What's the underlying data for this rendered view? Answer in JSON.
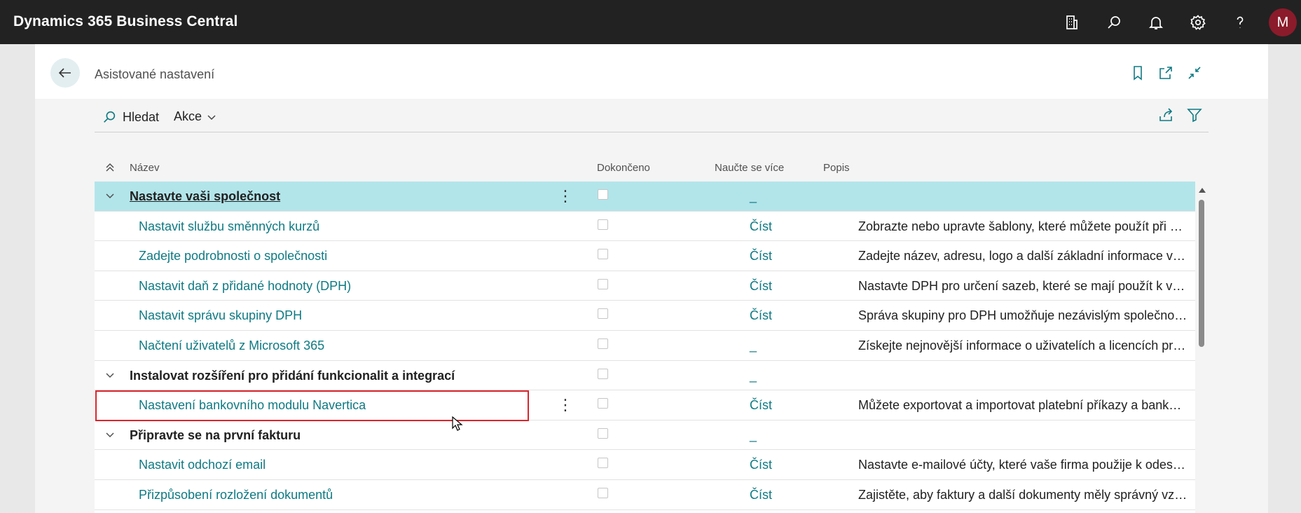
{
  "app": {
    "title": "Dynamics 365 Business Central",
    "avatar_initial": "M"
  },
  "page": {
    "title": "Asistované nastavení"
  },
  "toolbar": {
    "search_label": "Hledat",
    "actions_label": "Akce"
  },
  "columns": {
    "name": "Název",
    "completed": "Dokončeno",
    "learn_more": "Naučte se více",
    "description": "Popis"
  },
  "rows": [
    {
      "type": "group",
      "name": "Nastavte vaši společnost",
      "learn": "_",
      "desc": "",
      "selected": true
    },
    {
      "type": "item",
      "name": "Nastavit službu směnných kurzů",
      "learn": "Číst",
      "desc": "Zobrazte nebo upravte šablony, které můžete použít při vytváření i…"
    },
    {
      "type": "item",
      "name": "Zadejte podrobnosti o společnosti",
      "learn": "Číst",
      "desc": "Zadejte název, adresu, logo a další základní informace vaší společn…"
    },
    {
      "type": "item",
      "name": "Nastavit daň z přidané hodnoty (DPH)",
      "learn": "Číst",
      "desc": "Nastavte DPH pro určení sazeb, které se mají použít k výpočtu část…"
    },
    {
      "type": "item",
      "name": "Nastavit správu skupiny DPH",
      "learn": "Číst",
      "desc": "Správa skupiny pro DPH umožňuje nezávislým společnostem vstou…"
    },
    {
      "type": "item",
      "name": "Načtení uživatelů z Microsoft 365",
      "learn": "_",
      "desc": "Získejte nejnovější informace o uživatelích a licencích pro Business …"
    },
    {
      "type": "group",
      "name": "Instalovat rozšíření pro přidání funkcionalit a integrací",
      "learn": "_",
      "desc": ""
    },
    {
      "type": "item",
      "name": "Nastavení bankovního modulu Navertica",
      "learn": "Číst",
      "desc": "Můžete exportovat a importovat platební příkazy a bankovní výpisy.",
      "menu": true
    },
    {
      "type": "group",
      "name": "Připravte se na první fakturu",
      "learn": "_",
      "desc": ""
    },
    {
      "type": "item",
      "name": "Nastavit odchozí email",
      "learn": "Číst",
      "desc": "Nastavte e-mailové účty, které vaše firma použije k odesílání faktur…"
    },
    {
      "type": "item",
      "name": "Přizpůsobení rozložení dokumentů",
      "learn": "Číst",
      "desc": "Zajistěte, aby faktury a další dokumenty měly správný vzhled."
    }
  ],
  "colors": {
    "topbar": "#222222",
    "accent": "#0e7a83",
    "selected_row": "#b2e5ea",
    "avatar": "#8b1b2a",
    "highlight": "#d9262c"
  },
  "icons": {
    "top": [
      "company-icon",
      "search-icon",
      "bell-icon",
      "gear-icon",
      "help-icon"
    ],
    "header": [
      "bookmark-icon",
      "open-new-window-icon",
      "collapse-icon"
    ],
    "toolbar": [
      "share-icon",
      "filter-icon"
    ]
  }
}
